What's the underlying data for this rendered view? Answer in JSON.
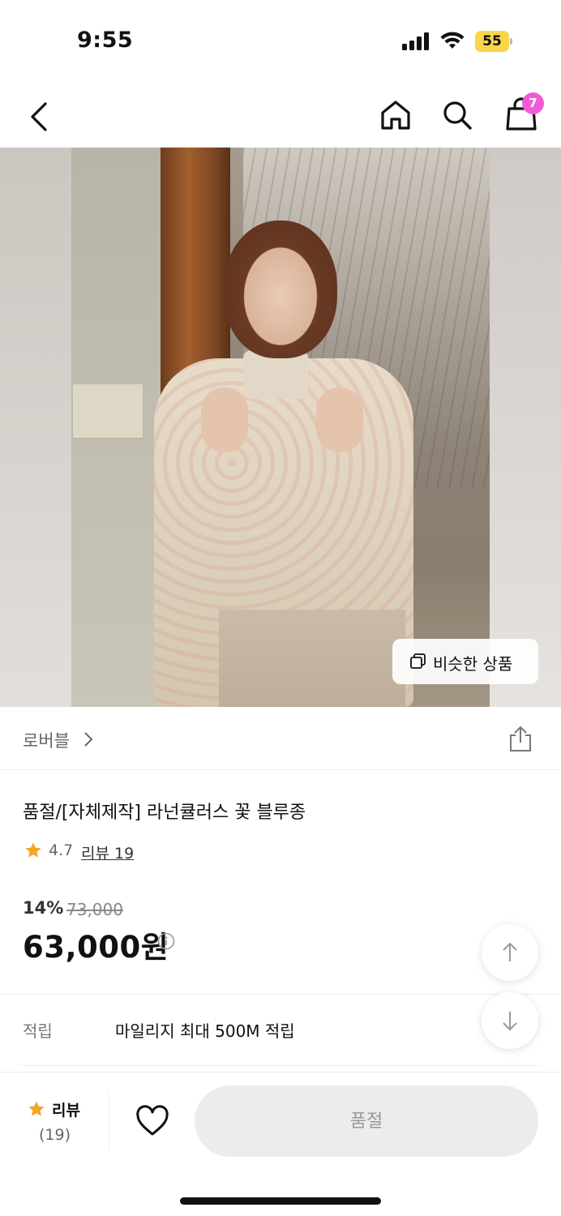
{
  "status_bar": {
    "time": "9:55",
    "battery": "55"
  },
  "nav": {
    "cart_count": "7"
  },
  "hero": {
    "similar_label": "비슷한 상품"
  },
  "seller": {
    "name": "로버블"
  },
  "product": {
    "title": "품절/[자체제작] 라넌큘러스 꽃 블루종",
    "rating": "4.7",
    "review_link": "리뷰 19",
    "discount": "14%",
    "original_price": "73,000",
    "price": "63,000원"
  },
  "mileage": {
    "label": "적립",
    "text": "마일리지 최대 500M 적립"
  },
  "bottom_bar": {
    "review_label": "리뷰",
    "review_count": "(19)",
    "action_label": "품절"
  },
  "colors": {
    "badge": "#f25bd7",
    "star": "#f5a623",
    "battery": "#f9d648",
    "disabled_button": "#ececec"
  }
}
